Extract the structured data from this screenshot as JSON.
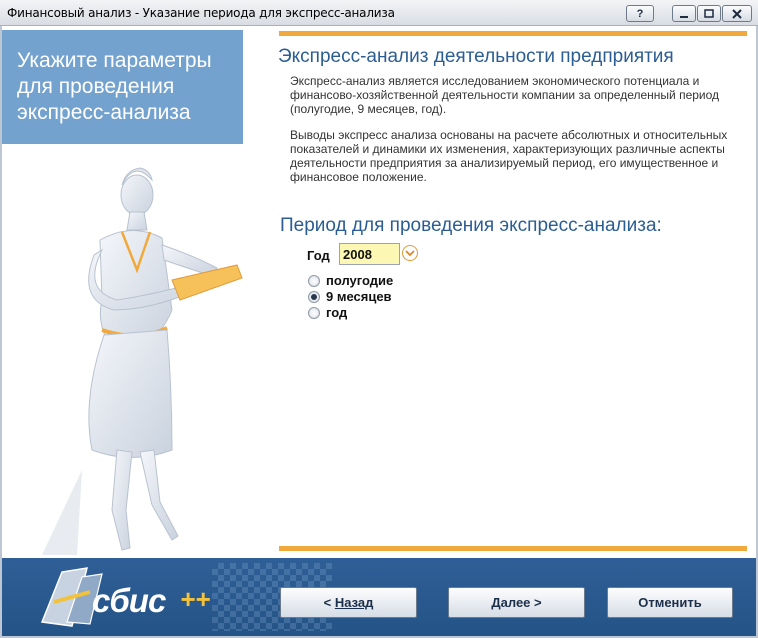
{
  "window": {
    "title": "Финансовый анализ - Указание периода для экспресс-анализа",
    "help_label": "?",
    "min_label": "–",
    "max_label": "□",
    "close_label": "✕"
  },
  "left_panel": {
    "heading": "Укажите параметры для проведения экспресс-анализа"
  },
  "main": {
    "section_title": "Экспресс-анализ деятельности предприятия",
    "para1": "Экспресс-анализ является исследованием экономического потенциала и финансово-хозяйственной деятельности компании за определенный период (полугодие, 9 месяцев, год).",
    "para2": "Выводы экспресс анализа основаны на расчете абсолютных и относительных показателей и динамики их изменения, характеризующих различные аспекты деятельности предприятия за анализируемый период, его имущественное и финансовое положение.",
    "period_title": "Период для проведения экспресс-анализа:",
    "year_label": "Год",
    "year_value": "2008",
    "options": [
      {
        "label": "полугодие",
        "selected": false
      },
      {
        "label": "9 месяцев",
        "selected": true
      },
      {
        "label": "год",
        "selected": false
      }
    ]
  },
  "footer": {
    "logo_text": "сбис",
    "logo_plus": "++",
    "back_prefix": "< ",
    "back_label": "Назад",
    "next_label": "Далее >",
    "cancel_label": "Отменить"
  },
  "colors": {
    "accent_orange": "#f2a93b",
    "header_blue": "#73a2cf",
    "footer_blue": "#2f5f96",
    "title_blue": "#2b5d93",
    "year_field": "#fcf7b2"
  }
}
